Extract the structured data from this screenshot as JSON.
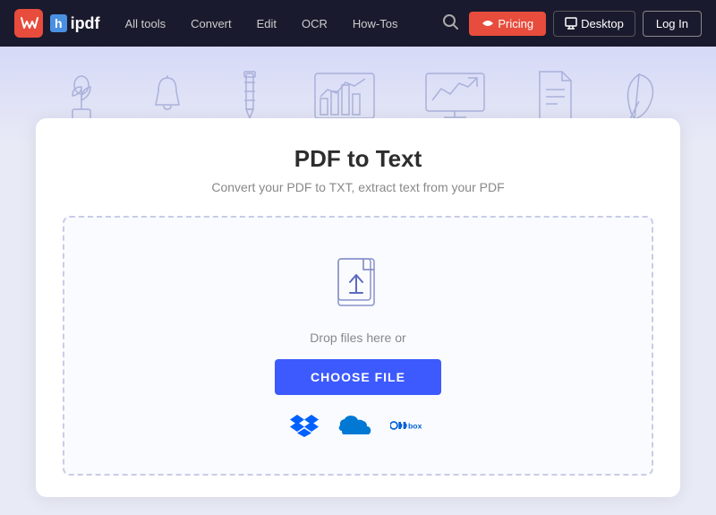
{
  "navbar": {
    "brand_ws": "Ws",
    "brand_name": "hipdf",
    "links": [
      {
        "label": "All tools",
        "id": "all-tools"
      },
      {
        "label": "Convert",
        "id": "convert"
      },
      {
        "label": "Edit",
        "id": "edit"
      },
      {
        "label": "OCR",
        "id": "ocr"
      },
      {
        "label": "How-Tos",
        "id": "how-tos"
      }
    ],
    "pricing_label": "Pricing",
    "desktop_label": "Desktop",
    "login_label": "Log In"
  },
  "page": {
    "title": "PDF to Text",
    "subtitle": "Convert your PDF to TXT, extract text from your PDF",
    "drop_text": "Drop files here or",
    "choose_file_label": "CHOOSE FILE"
  },
  "colors": {
    "accent_blue": "#3d5afe",
    "pricing_red": "#e74c3c",
    "nav_bg": "#1a1a2e",
    "dropbox_blue": "#0061ff",
    "onedrive_blue": "#0078d4",
    "box_blue": "#0061d5"
  }
}
